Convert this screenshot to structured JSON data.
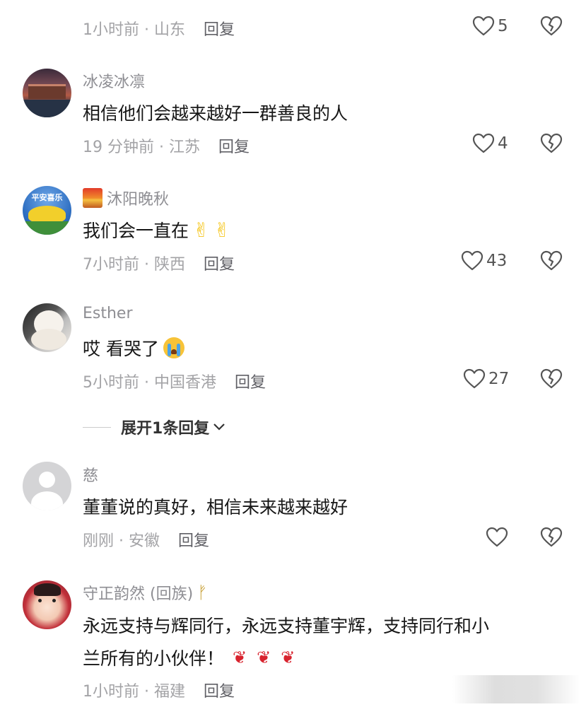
{
  "top_meta": {
    "time": "1小时前 · 山东",
    "reply": "回复",
    "likes": "5"
  },
  "comments": [
    {
      "user": "冰凌冰凛",
      "text": "相信他们会越来越好一群善良的人",
      "time": "19 分钟前 · 江苏",
      "reply": "回复",
      "likes": "4"
    },
    {
      "user": "沐阳晚秋",
      "text": "我们会一直在",
      "time": "7小时前 · 陕西",
      "reply": "回复",
      "likes": "43"
    },
    {
      "user": "Esther",
      "text": "哎 看哭了",
      "time": "5小时前 · 中国香港",
      "reply": "回复",
      "likes": "27"
    },
    {
      "user": "慈",
      "text": "董董说的真好，相信未来越来越好",
      "time": "刚刚 · 安徽",
      "reply": "回复",
      "likes": ""
    },
    {
      "user": "守正韵然 (回族)",
      "text_line1": "永远支持与辉同行，永远支持董宇辉，支持同行和小",
      "text_line2": "兰所有的小伙伴！",
      "time": "1小时前 · 福建",
      "reply": "回复"
    }
  ],
  "expand": {
    "label": "展开1条回复"
  },
  "avatar_text": {
    "pingan": "平安喜乐"
  },
  "icons": {
    "like": "heart-outline-icon",
    "dislike": "broken-heart-icon",
    "expand": "chevron-down-icon"
  },
  "colors": {
    "meta": "#a3a3a6",
    "name": "#8e8e93",
    "text": "#161616"
  }
}
